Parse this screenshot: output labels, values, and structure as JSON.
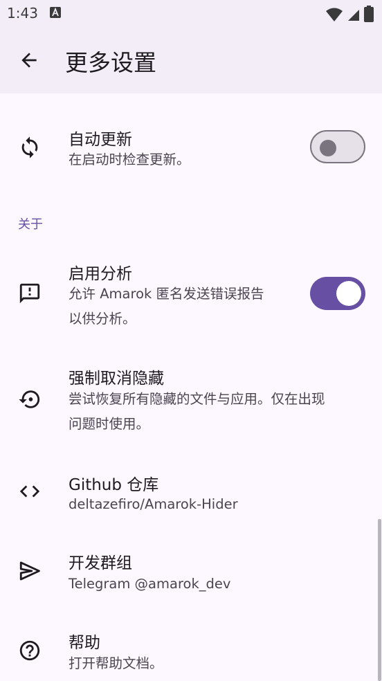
{
  "status_bar": {
    "time": "1:43"
  },
  "header": {
    "title": "更多设置"
  },
  "settings": {
    "auto_update": {
      "title": "自动更新",
      "subtitle": "在启动时检查更新。",
      "enabled": false
    },
    "about_section": {
      "label": "关于"
    },
    "analytics": {
      "title": "启用分析",
      "subtitle_line1": "允许 Amarok 匿名发送错误报告",
      "subtitle_line2": "以供分析。",
      "enabled": true
    },
    "force_unhide": {
      "title": "强制取消隐藏",
      "subtitle_line1": "尝试恢复所有隐藏的文件与应用。仅在出现",
      "subtitle_line2": "问题时使用。"
    },
    "github": {
      "title": "Github 仓库",
      "subtitle": "deltazefiro/Amarok-Hider"
    },
    "dev_group": {
      "title": "开发群组",
      "subtitle": "Telegram @amarok_dev"
    },
    "help": {
      "title": "帮助",
      "subtitle": "打开帮助文档。"
    }
  },
  "colors": {
    "accent": "#6750a4",
    "surface": "#fdf7ff",
    "app_bar": "#f3edf7"
  },
  "icons": [
    "back-arrow-icon",
    "sync-icon",
    "feedback-icon",
    "restore-icon",
    "code-icon",
    "send-icon",
    "help-icon"
  ]
}
